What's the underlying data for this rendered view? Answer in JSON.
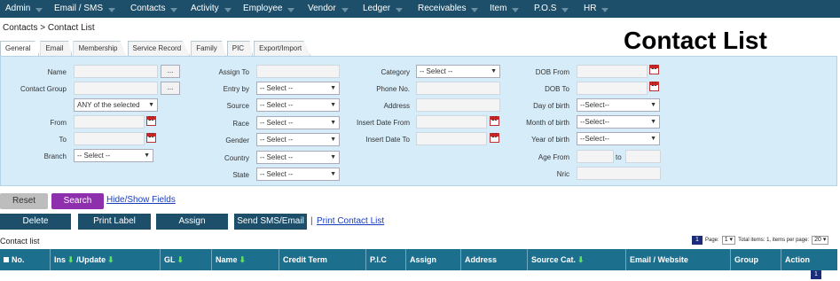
{
  "nav": {
    "items": [
      "Admin",
      "Email / SMS",
      "Contacts",
      "Activity",
      "Employee",
      "Vendor",
      "Ledger",
      "Receivables",
      "Item",
      "P.O.S",
      "HR"
    ]
  },
  "breadcrumb": "Contacts > Contact List",
  "page_title": "Contact List",
  "tabs": [
    "General",
    "Email",
    "Membership",
    "Service Record",
    "Family",
    "PIC",
    "Export/Import"
  ],
  "form": {
    "name_label": "Name",
    "contact_group_label": "Contact Group",
    "any_of_selected": "ANY of the selected",
    "from_label": "From",
    "to_label": "To",
    "branch_label": "Branch",
    "branch_value": "-- Select --",
    "browse_label": "...",
    "assign_to_label": "Assign To",
    "entry_by_label": "Entry by",
    "source_label": "Source",
    "race_label": "Race",
    "gender_label": "Gender",
    "country_label": "Country",
    "state_label": "State",
    "select_value": "-- Select --",
    "category_label": "Category",
    "category_value": "-- Select --",
    "phone_label": "Phone No.",
    "address_label": "Address",
    "insert_from_label": "Insert Date From",
    "insert_to_label": "Insert Date To",
    "dob_from_label": "DOB From",
    "dob_to_label": "DOB To",
    "day_label": "Day of birth",
    "month_label": "Month of birth",
    "year_label": "Year of birth",
    "select_alt": "--Select--",
    "age_from_label": "Age From",
    "age_to_label": "to",
    "nric_label": "Nric",
    "calendar_glyph": "10"
  },
  "actions": {
    "reset": "Reset",
    "search": "Search",
    "hide_show": "Hide/Show Fields",
    "delete": "Delete",
    "print_label": "Print Label",
    "assign": "Assign",
    "send_sms": "Send SMS/Email",
    "separator": "|",
    "print_contact_list": "Print Contact List"
  },
  "list": {
    "label": "Contact list",
    "page_number": "1",
    "page_text": "Page:",
    "page_select": "1",
    "total_text": "Total items: 1, items per page:",
    "per_page": "20",
    "bottom_page": "1"
  },
  "table": {
    "columns": [
      "No.",
      "Ins",
      "/Update",
      "GL",
      "Name",
      "Credit Term",
      "P.I.C",
      "Assign",
      "Address",
      "Source Cat.",
      "Email / Website",
      "Group",
      "Action"
    ]
  },
  "colors": {
    "nav_bg": "#1d4f6a",
    "panel_bg": "#d6ecf9",
    "action_button": "#1d4f6a",
    "search_button": "#8e2fae",
    "table_header": "#1d6f8e"
  }
}
